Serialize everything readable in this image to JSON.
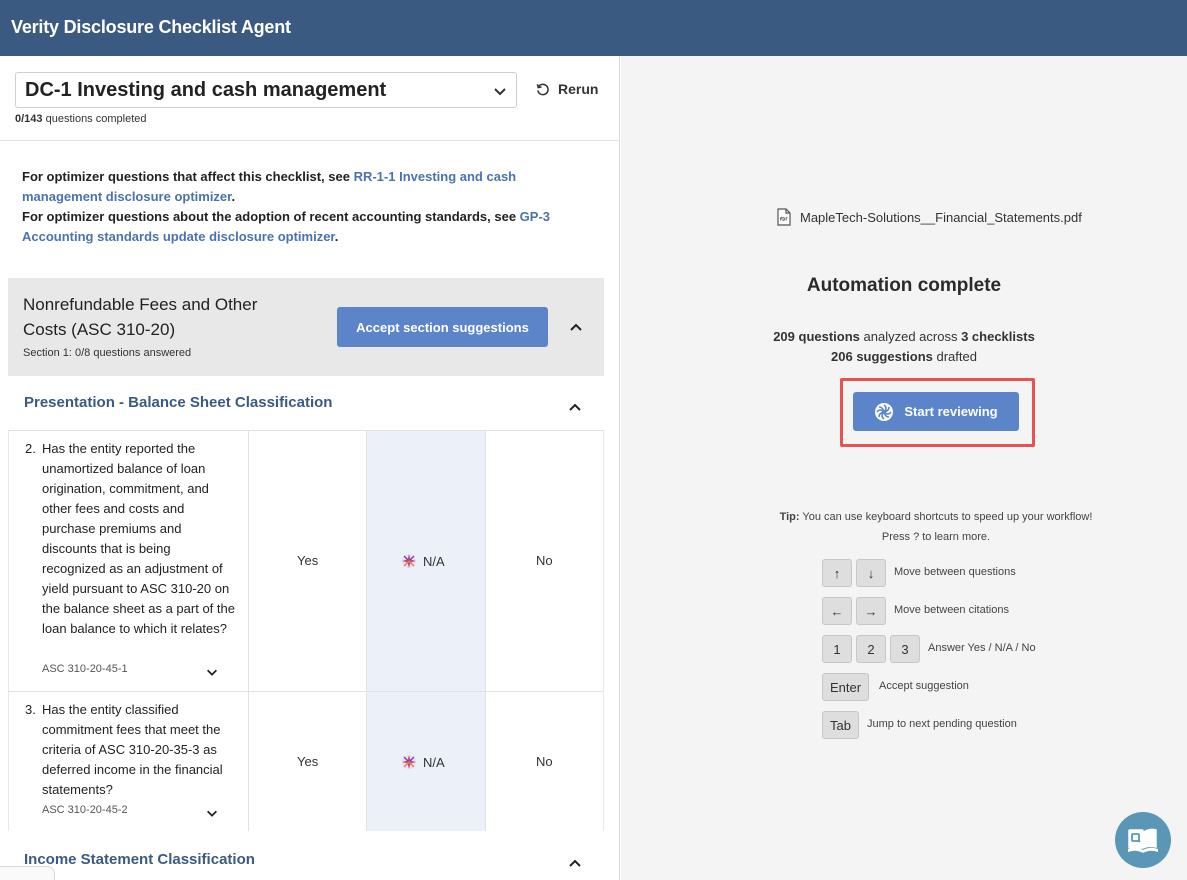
{
  "app": {
    "title": "Verity Disclosure Checklist Agent"
  },
  "checklist": {
    "selected": "DC-1 Investing and cash management",
    "progress_count": "0/143",
    "progress_label": "questions completed",
    "rerun_label": "Rerun"
  },
  "notes": {
    "line1_prefix": "For optimizer questions that affect this checklist, see ",
    "line1_link": "RR-1-1 Investing and cash management disclosure optimizer",
    "line1_suffix": ".",
    "line2_prefix": "For optimizer questions about the adoption of recent accounting standards, see ",
    "line2_link": "GP-3 Accounting standards update disclosure optimizer",
    "line2_suffix": "."
  },
  "section": {
    "title": "Nonrefundable Fees and Other Costs (ASC 310-20)",
    "subtitle": "Section 1: 0/8 questions answered",
    "accept_label": "Accept section suggestions"
  },
  "subsections": [
    {
      "title": "Presentation - Balance Sheet Classification"
    },
    {
      "title": "Income Statement Classification"
    }
  ],
  "questions": [
    {
      "number": "2.",
      "text": "Has the entity reported the unamortized balance of loan origination, commitment, and other fees and costs and purchase premiums and discounts that is being recognized as an adjustment of yield pursuant to ASC 310-20 on the balance sheet as a part of the loan balance to which it relates?",
      "reference": "ASC 310-20-45-1",
      "yes": "Yes",
      "na": "N/A",
      "no": "No"
    },
    {
      "number": "3.",
      "text": "Has the entity classified commitment fees that meet the criteria of ASC 310-20-35-3 as deferred income in the financial statements?",
      "reference": "ASC 310-20-45-2",
      "yes": "Yes",
      "na": "N/A",
      "no": "No"
    }
  ],
  "panel": {
    "file_icon": "pdf-file-icon",
    "file_name": "MapleTech-Solutions__Financial_Statements.pdf",
    "status_title": "Automation complete",
    "questions_count": "209 questions",
    "analyzed_text": " analyzed across ",
    "checklists_count": "3 checklists",
    "suggestions_count": "206 suggestions",
    "drafted_text": " drafted",
    "start_label": "Start reviewing",
    "tip_bold": "Tip:",
    "tip_text": " You can use keyboard shortcuts to speed up your workflow!",
    "tip_line2": "Press ? to learn more."
  },
  "shortcuts": [
    {
      "keys": [
        "↑",
        "↓"
      ],
      "description": "Move between questions"
    },
    {
      "keys": [
        "←",
        "→"
      ],
      "description": "Move between citations"
    },
    {
      "keys": [
        "1",
        "2",
        "3"
      ],
      "description": "Answer Yes / N/A / No"
    },
    {
      "keys": [
        "Enter"
      ],
      "description": "Accept suggestion"
    },
    {
      "keys": [
        "Tab"
      ],
      "description": "Jump to next pending question"
    }
  ],
  "colors": {
    "header": "#3b5a82",
    "accent_button": "#5b85c8",
    "link": "#4a72b0",
    "highlight": "#e55353",
    "na_column": "#ecf0f8"
  }
}
